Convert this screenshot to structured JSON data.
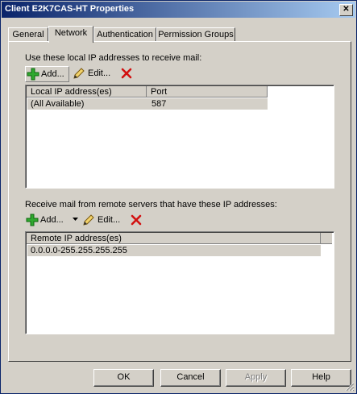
{
  "window": {
    "title": "Client E2K7CAS-HT Properties",
    "close_glyph": "✕"
  },
  "tabs": [
    {
      "label": "General"
    },
    {
      "label": "Network"
    },
    {
      "label": "Authentication"
    },
    {
      "label": "Permission Groups"
    }
  ],
  "local": {
    "caption": "Use these local IP addresses to receive mail:",
    "add_label": "Add...",
    "edit_label": "Edit...",
    "columns": [
      "Local IP address(es)",
      "Port"
    ],
    "rows": [
      {
        "address": "(All Available)",
        "port": "587"
      }
    ]
  },
  "remote": {
    "caption": "Receive mail from remote servers that have these IP addresses:",
    "add_label": "Add...",
    "edit_label": "Edit...",
    "columns": [
      "Remote IP address(es)"
    ],
    "rows": [
      {
        "address": "0.0.0.0-255.255.255.255"
      }
    ]
  },
  "buttons": {
    "ok": "OK",
    "cancel": "Cancel",
    "apply": "Apply",
    "help": "Help"
  },
  "colors": {
    "title_start": "#0a246a",
    "title_end": "#a6caf0",
    "add_icon": "#2fa82f",
    "delete_icon": "#d21010"
  },
  "icons": {
    "add": "add-icon",
    "edit": "pencil-icon",
    "delete": "delete-icon",
    "dropdown": "dropdown-arrow-icon"
  }
}
